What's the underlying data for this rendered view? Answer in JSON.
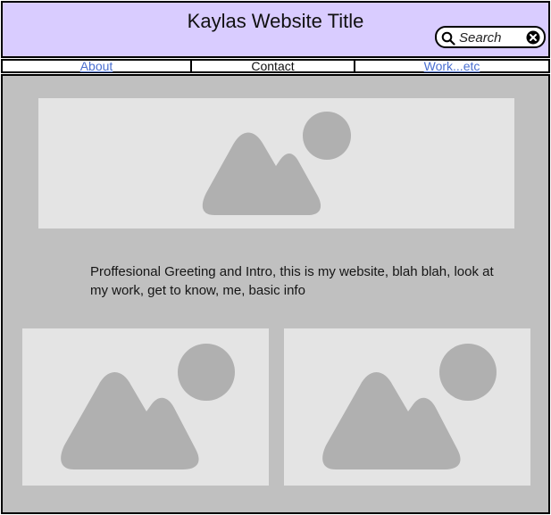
{
  "header": {
    "site_title": "Kaylas Website Title",
    "search": {
      "placeholder": "Search",
      "icon": "search-icon",
      "clear_icon": "close-circle-icon"
    }
  },
  "nav": {
    "items": [
      {
        "label": "About",
        "style": "link"
      },
      {
        "label": "Contact",
        "style": "plain"
      },
      {
        "label": "Work...etc",
        "style": "link"
      }
    ]
  },
  "main": {
    "intro_text": "Proffesional Greeting and Intro, this is my website, blah blah, look at my work, get to know, me, basic info",
    "images": [
      {
        "icon": "image-placeholder-icon"
      },
      {
        "icon": "image-placeholder-icon"
      },
      {
        "icon": "image-placeholder-icon"
      }
    ]
  },
  "colors": {
    "header_bg": "#d9ccff",
    "main_bg": "#c0c0c0",
    "placeholder_bg": "#e4e4e4",
    "placeholder_shape": "#b0b0b0",
    "link": "#4a6fd0"
  }
}
